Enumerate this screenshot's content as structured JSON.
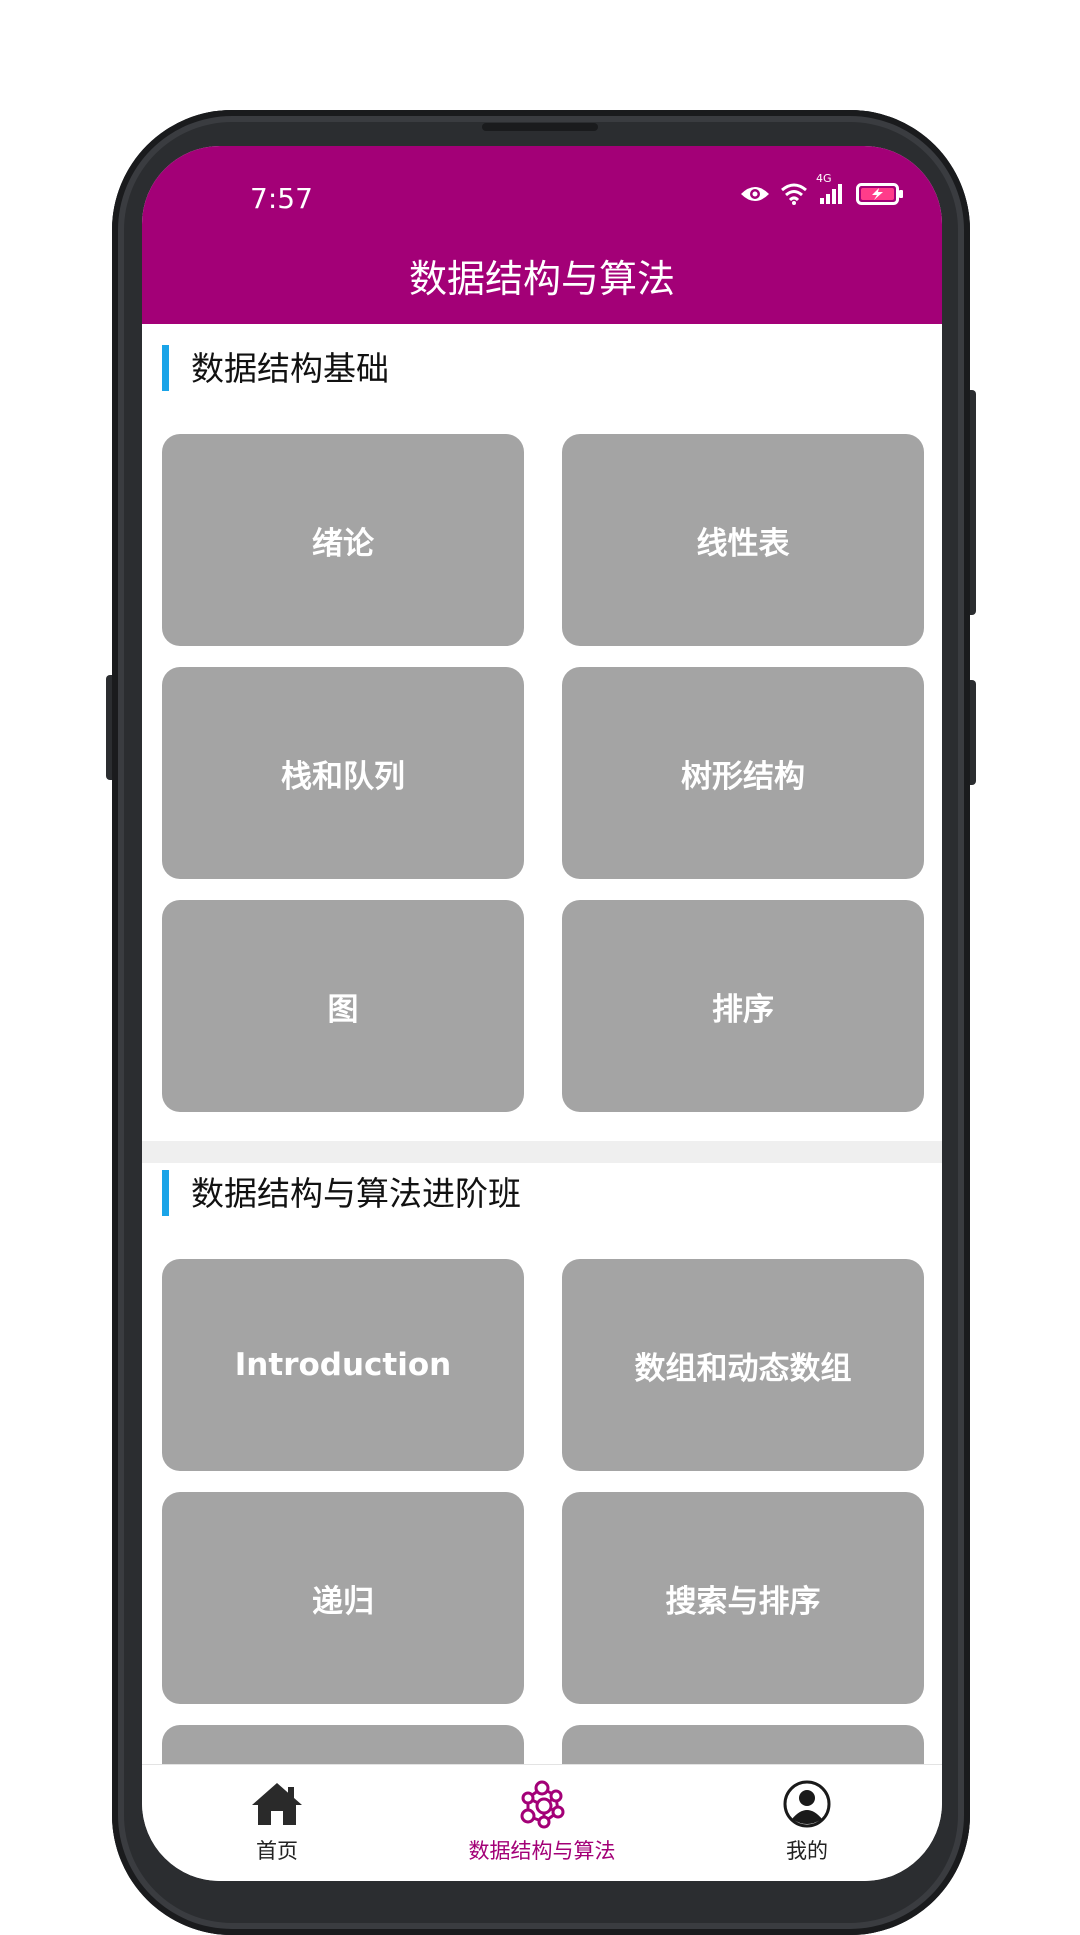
{
  "status_bar": {
    "time": "7:57",
    "network_label": "4G"
  },
  "header": {
    "title": "数据结构与算法",
    "color": "#a30077"
  },
  "sections": [
    {
      "title": "数据结构基础",
      "accent": "#1aa4e8",
      "items": [
        "绪论",
        "线性表",
        "栈和队列",
        "树形结构",
        "图",
        "排序"
      ]
    },
    {
      "title": "数据结构与算法进阶班",
      "accent": "#1aa4e8",
      "items": [
        "Introduction",
        "数组和动态数组",
        "递归",
        "搜索与排序"
      ]
    }
  ],
  "tabbar": {
    "tabs": [
      {
        "label": "首页",
        "icon": "home-icon",
        "active": false
      },
      {
        "label": "数据结构与算法",
        "icon": "network-icon",
        "active": true
      },
      {
        "label": "我的",
        "icon": "profile-icon",
        "active": false
      }
    ],
    "active_color": "#a30077"
  },
  "card_color": "#a4a4a4"
}
